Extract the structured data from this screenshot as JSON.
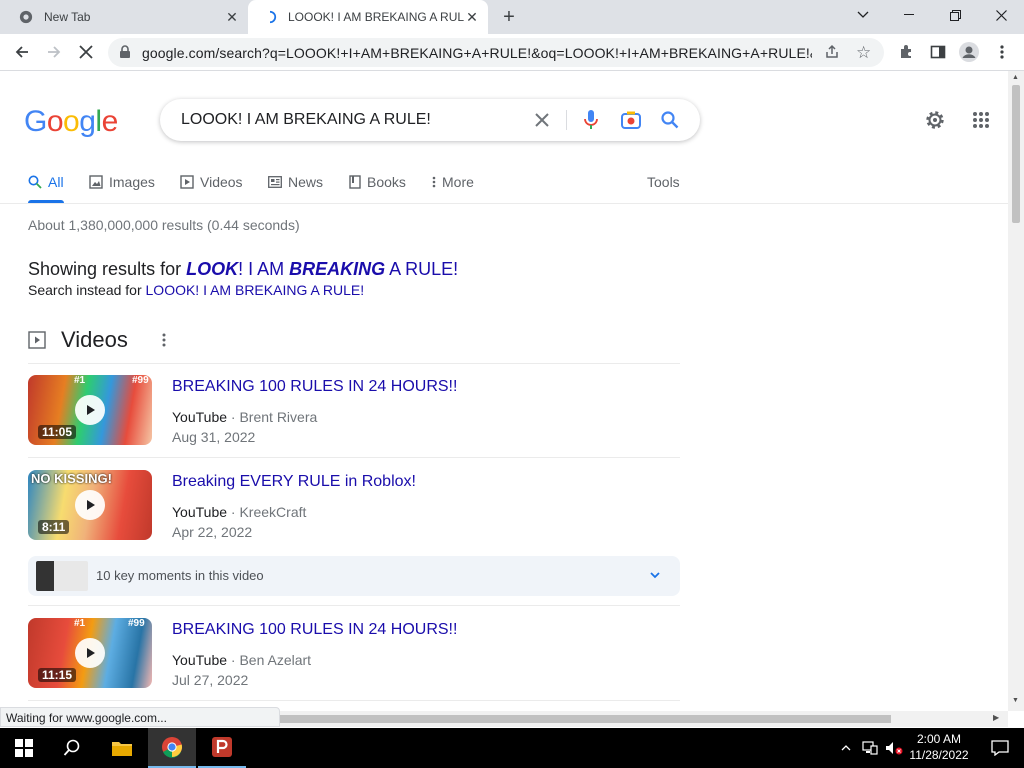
{
  "browser": {
    "tabs": [
      {
        "title": "New Tab"
      },
      {
        "title": "LOOOK! I AM BREKAING A RULE! - Google Search"
      }
    ],
    "url": "google.com/search?q=LOOOK!+I+AM+BREKAING+A+RULE!&oq=LOOOK!+I+AM+BREKAING+A+RULE!&a...",
    "status": "Waiting for www.google.com..."
  },
  "google": {
    "logo": "Google",
    "logo_colors": [
      "#4285f4",
      "#ea4335",
      "#fbbc05",
      "#4285f4",
      "#34a853",
      "#ea4335"
    ],
    "query": "LOOOK! I AM BREKAING A RULE!",
    "nav_tabs": [
      "All",
      "Images",
      "Videos",
      "News",
      "Books",
      "More"
    ],
    "tools": "Tools",
    "stats": "About 1,380,000,000 results (0.44 seconds)",
    "showing_prefix": "Showing results for ",
    "corrected": {
      "w1": "LOOK",
      "p1": "! I AM ",
      "w2": "BREAKING",
      "p2": " A RULE!"
    },
    "instead_prefix": "Search instead for ",
    "instead_link": "LOOOK! I AM BREKAING A RULE!",
    "videos_heading": "Videos",
    "videos": [
      {
        "title": "BREAKING 100 RULES IN 24 HOURS!!",
        "source": "YouTube",
        "channel": "Brent Rivera",
        "date": "Aug 31, 2022",
        "duration": "11:05"
      },
      {
        "title": "Breaking EVERY RULE in Roblox!",
        "source": "YouTube",
        "channel": "KreekCraft",
        "date": "Apr 22, 2022",
        "duration": "8:11"
      },
      {
        "title": "BREAKING 100 RULES IN 24 HOURS!!",
        "source": "YouTube",
        "channel": "Ben Azelart",
        "date": "Jul 27, 2022",
        "duration": "11:15"
      }
    ],
    "key_moments": "10 key moments in this video",
    "thumb_overlays": {
      "v1_rank": "#1",
      "v1_rank2": "#99",
      "v2_caption": "NO KISSING!",
      "v3_rank": "#1",
      "v3_rank2": "#99"
    }
  },
  "taskbar": {
    "time": "2:00 AM",
    "date": "11/28/2022"
  },
  "colors": {
    "link": "#1a0dab",
    "accent": "#1a73e8"
  }
}
